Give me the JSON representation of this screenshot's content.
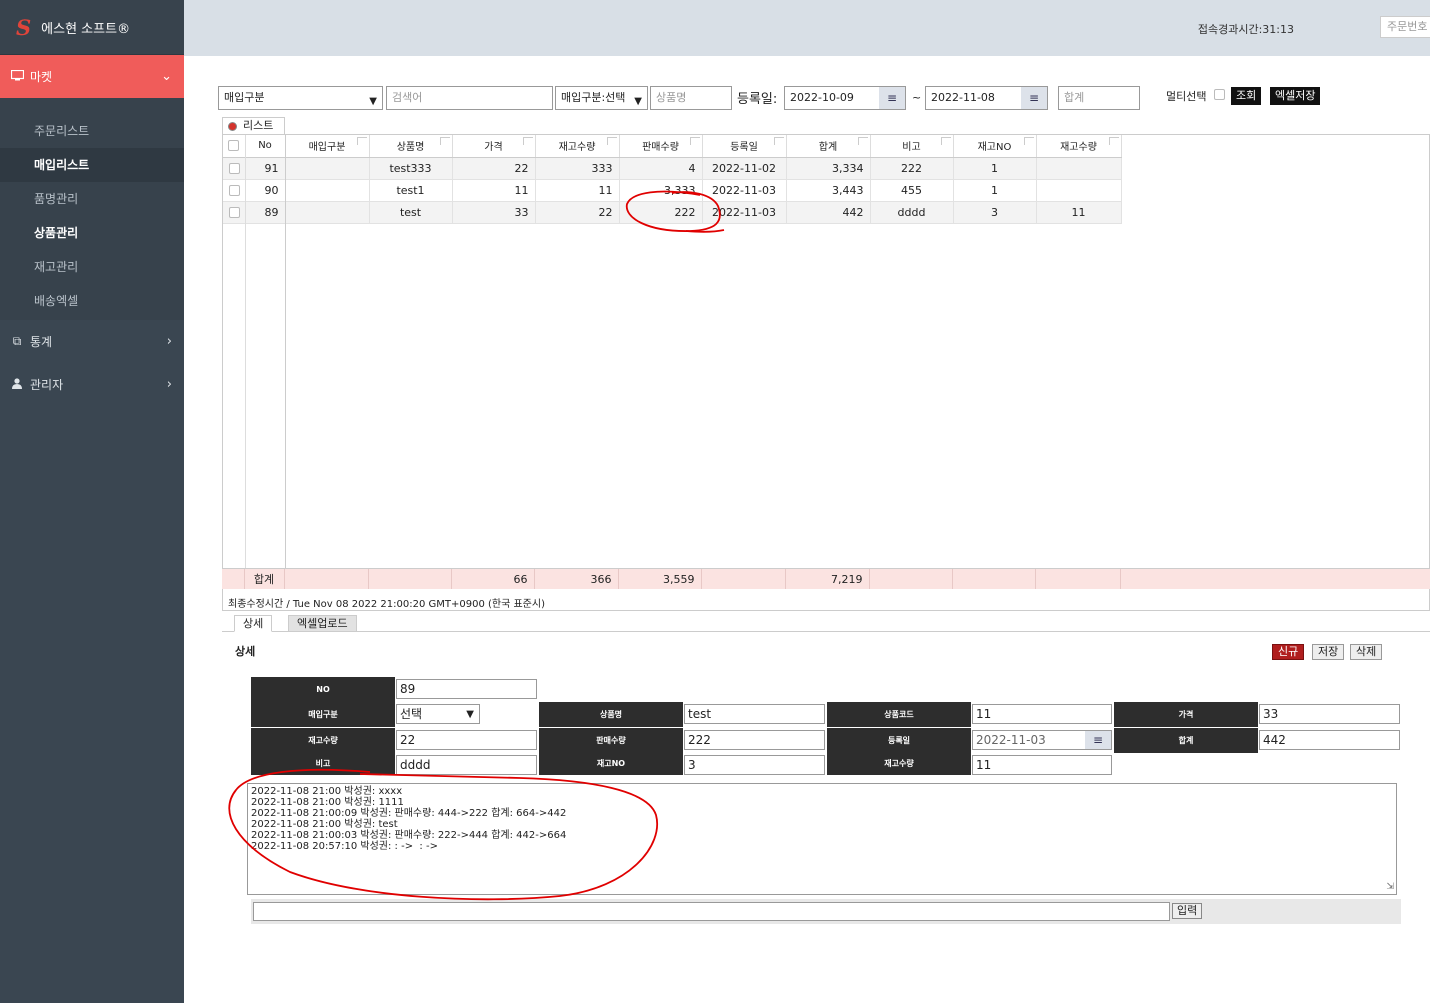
{
  "app": {
    "logo_letter": "S",
    "title": "에스현 소프트®"
  },
  "topbar": {
    "elapsed": "접속경과시간:31:13",
    "order_placeholder": "주문번호"
  },
  "sidebar": {
    "market": {
      "label": "마켓",
      "icon": "monitor-icon"
    },
    "items": [
      {
        "label": "주문리스트"
      },
      {
        "label": "매입리스트"
      },
      {
        "label": "품명관리"
      },
      {
        "label": "상품관리"
      },
      {
        "label": "재고관리"
      },
      {
        "label": "배송엑셀"
      }
    ],
    "stats": {
      "label": "통계",
      "icon": "copy-icon"
    },
    "admin": {
      "label": "관리자",
      "icon": "user-icon"
    }
  },
  "filters": {
    "purchase_type": "매입구분",
    "search_ph": "검색어",
    "purchase_select": "매입구분:선택",
    "product_ph": "상품명",
    "reg_label": "등록일:",
    "date_from": "2022-10-09",
    "tilde": "~",
    "date_to": "2022-11-08",
    "sum_ph": "합계",
    "multi_label": "멀티선택",
    "search_btn": "조회",
    "excel_btn": "엑셀저장"
  },
  "list_tab": "리스트",
  "grid": {
    "headers": [
      "No",
      "매입구분",
      "상품명",
      "가격",
      "재고수량",
      "판매수량",
      "등록일",
      "합계",
      "비고",
      "재고NO",
      "재고수량"
    ],
    "rows": [
      [
        "91",
        "",
        "test333",
        "22",
        "333",
        "4",
        "2022-11-02",
        "3,334",
        "222",
        "1",
        ""
      ],
      [
        "90",
        "",
        "test1",
        "11",
        "11",
        "3,333",
        "2022-11-03",
        "3,443",
        "455",
        "1",
        ""
      ],
      [
        "89",
        "",
        "test",
        "33",
        "22",
        "222",
        "2022-11-03",
        "442",
        "dddd",
        "3",
        "11"
      ]
    ],
    "totals": [
      "합계",
      "",
      "",
      "66",
      "366",
      "3,559",
      "",
      "7,219",
      "",
      "",
      ""
    ]
  },
  "last_modified": "최종수정시간 / Tue Nov 08 2022 21:00:20 GMT+0900 (한국 표준시)",
  "tabs": {
    "detail": "상세",
    "excel_upload": "엑셀업로드"
  },
  "detail": {
    "title": "상세",
    "new_btn": "신규",
    "save_btn": "저장",
    "delete_btn": "삭제",
    "labels": {
      "no": "NO",
      "purchase_type": "매입구분",
      "product": "상품명",
      "product_code": "상품코드",
      "price": "가격",
      "stock_qty": "재고수량",
      "sales_qty": "판매수량",
      "reg_date": "등록일",
      "total": "합계",
      "note": "비고",
      "stock_no": "재고NO",
      "stock_qty2": "재고수량"
    },
    "values": {
      "no": "89",
      "purchase_type": "선택",
      "product": "test",
      "product_code": "11",
      "price": "33",
      "stock_qty": "22",
      "sales_qty": "222",
      "reg_date": "2022-11-03",
      "total": "442",
      "note": "dddd",
      "stock_no": "3",
      "stock_qty2": "11"
    }
  },
  "log": "2022-11-08 21:00 박성권: xxxx\n2022-11-08 21:00 박성권: 1111\n2022-11-08 21:00:09 박성권: 판매수량: 444->222 합계: 664->442\n2022-11-08 21:00 박성권: test\n2022-11-08 21:00:03 박성권: 판매수량: 222->444 합계: 442->664\n2022-11-08 20:57:10 박성권: : ->  : ->",
  "input_btn": "입력",
  "colors": {
    "accent": "#f05c5a",
    "sidebar": "#3a4651",
    "annotation": "#e00000"
  }
}
